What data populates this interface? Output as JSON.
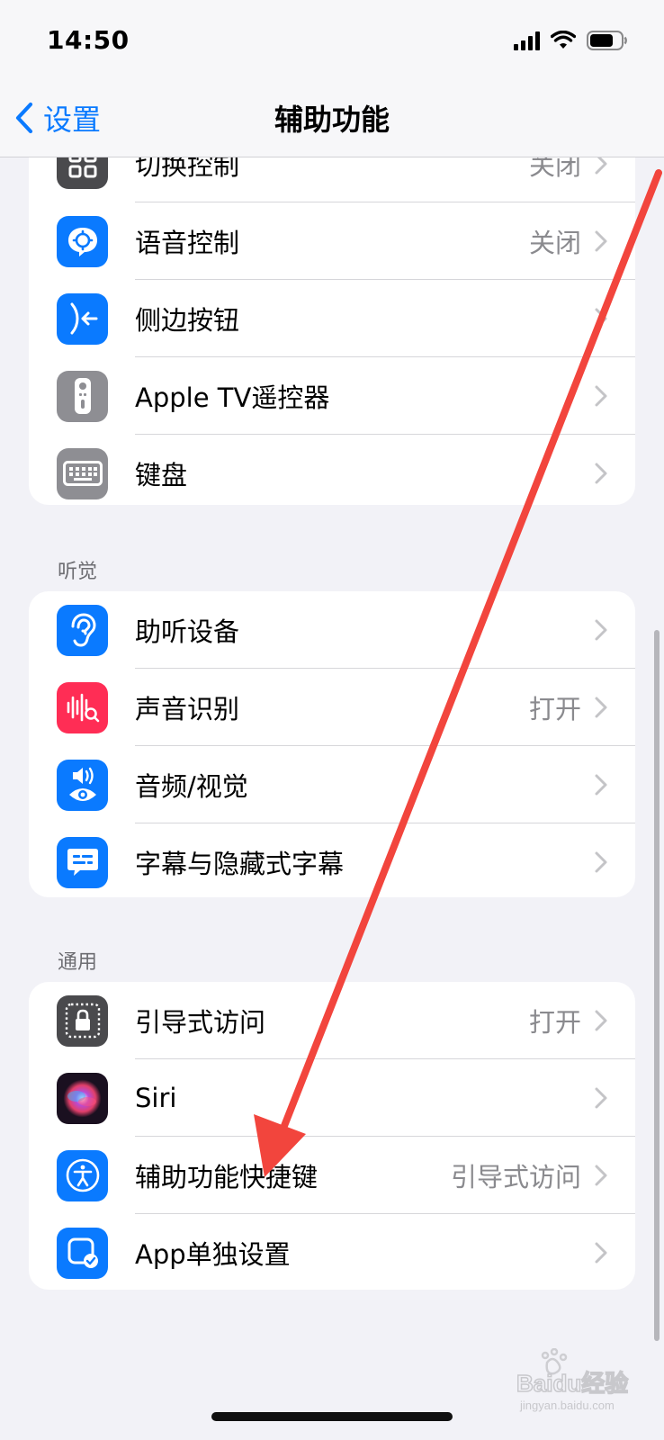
{
  "status_bar": {
    "time": "14:50"
  },
  "nav": {
    "back_label": "设置",
    "title": "辅助功能"
  },
  "sections": {
    "motor": {
      "items": [
        {
          "label": "切换控制",
          "value": "关闭"
        },
        {
          "label": "语音控制",
          "value": "关闭"
        },
        {
          "label": "侧边按钮",
          "value": ""
        },
        {
          "label": "Apple TV遥控器",
          "value": ""
        },
        {
          "label": "键盘",
          "value": ""
        }
      ]
    },
    "hearing": {
      "header": "听觉",
      "items": [
        {
          "label": "助听设备",
          "value": ""
        },
        {
          "label": "声音识别",
          "value": "打开"
        },
        {
          "label": "音频/视觉",
          "value": ""
        },
        {
          "label": "字幕与隐藏式字幕",
          "value": ""
        }
      ]
    },
    "general": {
      "header": "通用",
      "items": [
        {
          "label": "引导式访问",
          "value": "打开"
        },
        {
          "label": "Siri",
          "value": ""
        },
        {
          "label": "辅助功能快捷键",
          "value": "引导式访问"
        },
        {
          "label": "App单独设置",
          "value": ""
        }
      ]
    }
  },
  "watermark": {
    "text": "Baidu经验",
    "subtext": "jingyan.baidu.com"
  },
  "colors": {
    "accent": "#0a7aff",
    "annotation_arrow": "#f2453d"
  }
}
